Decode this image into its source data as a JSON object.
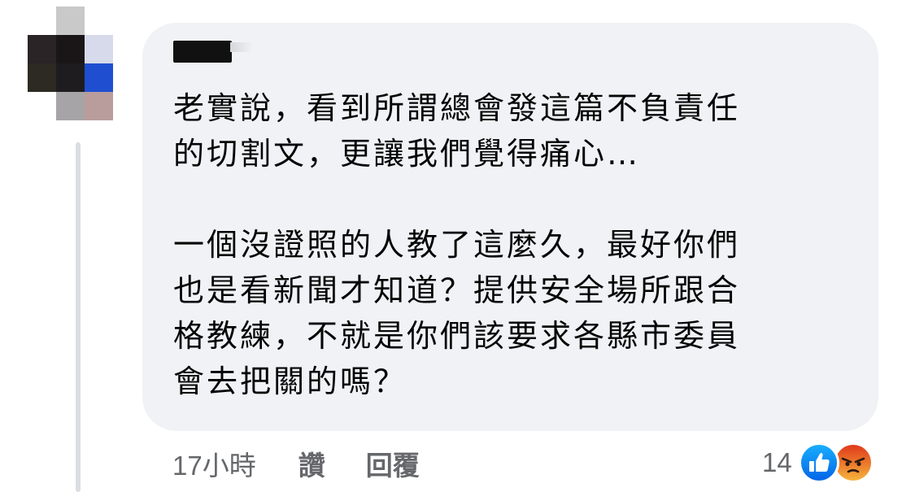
{
  "comment": {
    "author_name": "",
    "paragraphs": [
      "老實說，看到所謂總會發這篇不負責任\n的切割文，更讓我們覺得痛心…",
      "一個沒證照的人教了這麼久，最好你們\n也是看新聞才知道？提供安全場所跟合\n格教練，不就是你們該要求各縣市委員\n會去把關的嗎？"
    ]
  },
  "actions": {
    "timestamp": "17小時",
    "like_label": "讚",
    "reply_label": "回覆"
  },
  "reactions": {
    "count": "14",
    "icons": [
      "like-icon",
      "angry-icon"
    ]
  },
  "colors": {
    "bubble": "#f0f2f5",
    "text": "#050505",
    "secondary_text": "#65676b",
    "like_blue": "#1877f2",
    "angry_orange": "#f7714c"
  }
}
